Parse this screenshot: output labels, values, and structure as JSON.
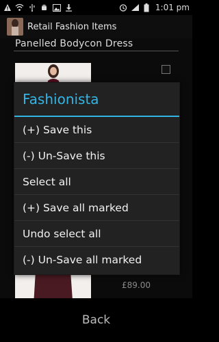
{
  "status_bar": {
    "time": "1:01 pm",
    "icons": [
      "warning-icon",
      "wifi-icon",
      "usb-icon",
      "android-icon",
      "image-icon",
      "download-icon",
      "alarm-icon",
      "signal-icon",
      "battery-icon"
    ]
  },
  "action_bar": {
    "title": "Retail Fashion Items"
  },
  "content": {
    "item_title": "Panelled Bodycon Dress",
    "price": "£89.00"
  },
  "dialog": {
    "title": "Fashionista",
    "items": [
      "(+) Save this",
      "(-) Un-Save this",
      "Select all",
      "(+) Save all marked",
      "Undo select all",
      "(-) Un-Save all marked"
    ]
  },
  "bottom": {
    "back_label": "Back"
  },
  "colors": {
    "accent": "#33b5e5",
    "dialog_bg": "#222222",
    "background": "#000000"
  }
}
